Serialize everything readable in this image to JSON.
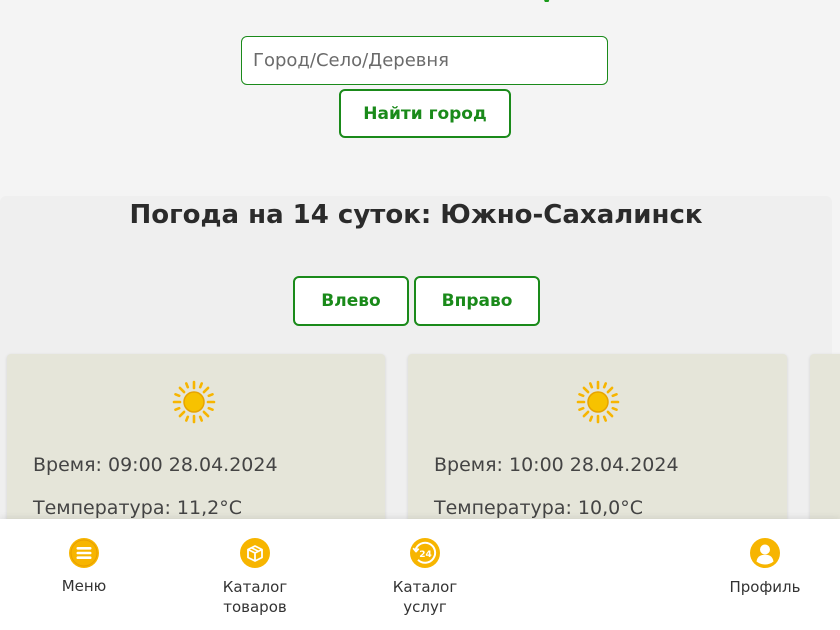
{
  "search": {
    "placeholder": "Город/Село/Деревня",
    "value": "",
    "find_label": "Найти город"
  },
  "forecast": {
    "title": "Погода на 14 суток: Южно-Сахалинск",
    "left_label": "Влево",
    "right_label": "Вправо",
    "cards": [
      {
        "icon": "sun-icon",
        "time": "Время: 09:00 28.04.2024",
        "temp": "Температура: 11,2°C"
      },
      {
        "icon": "sun-icon",
        "time": "Время: 10:00 28.04.2024",
        "temp": "Температура: 10,0°C"
      }
    ]
  },
  "nav": {
    "items": [
      {
        "label": "Меню",
        "icon": "menu-icon"
      },
      {
        "label": "Каталог\nтоваров",
        "icon": "box-icon"
      },
      {
        "label": "Каталог\nуслуг",
        "icon": "24h-icon"
      },
      {
        "label": "Профиль",
        "icon": "profile-icon"
      }
    ]
  },
  "colors": {
    "accent": "#1a8a1a",
    "icon": "#f7b500",
    "card": "#e5e5d9",
    "background": "#f4f4f4"
  }
}
